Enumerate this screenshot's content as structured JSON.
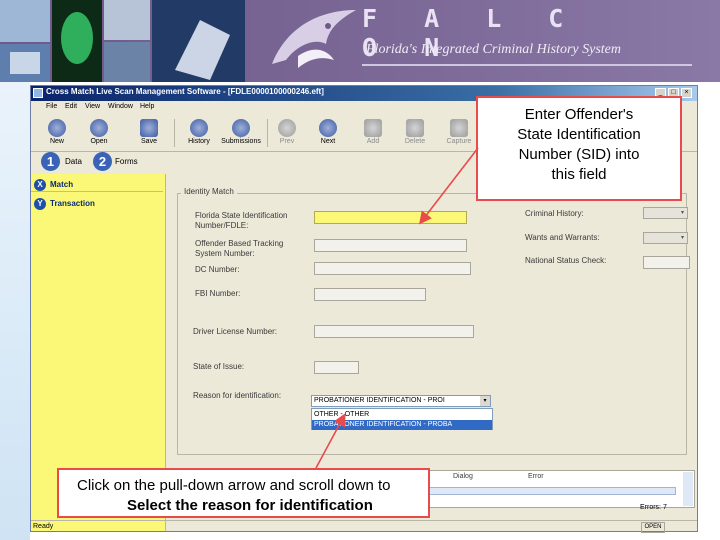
{
  "banner": {
    "title": "F A L C O N",
    "subtitle": "Florida's Integrated Criminal History System"
  },
  "window": {
    "title": "Cross Match Live Scan Management Software - [FDLE0000100000246.eft]",
    "controls": [
      "_",
      "□",
      "×"
    ]
  },
  "menu": [
    "File",
    "Edit",
    "View",
    "Window",
    "Help"
  ],
  "toolbar": [
    {
      "label": "New",
      "icon": "new-icon",
      "enabled": true
    },
    {
      "label": "Open",
      "icon": "open-folder-icon",
      "enabled": true
    },
    {
      "label": "Save",
      "icon": "save-disk-icon",
      "enabled": true
    },
    {
      "label": "History",
      "icon": "history-icon",
      "enabled": true
    },
    {
      "label": "Submissions",
      "icon": "submissions-icon",
      "enabled": true
    },
    {
      "label": "Prev",
      "icon": "prev-arrow-icon",
      "enabled": false
    },
    {
      "label": "Next",
      "icon": "next-arrow-icon",
      "enabled": true
    },
    {
      "label": "Add",
      "icon": "add-icon",
      "enabled": false
    },
    {
      "label": "Delete",
      "icon": "delete-icon",
      "enabled": false
    },
    {
      "label": "Capture",
      "icon": "capture-icon",
      "enabled": false
    }
  ],
  "wizard": [
    {
      "number": "1",
      "label": "Data"
    },
    {
      "number": "2",
      "label": "Forms"
    }
  ],
  "nav": [
    {
      "icon_glyph": "X",
      "label": "Match"
    },
    {
      "icon_glyph": "Y",
      "label": "Transaction"
    }
  ],
  "form": {
    "legend": "Identity Match",
    "sid_label": "Florida State Identification Number/FDLE:",
    "obts_label": "Offender Based Tracking System Number:",
    "dc_label": "DC Number:",
    "fbi_label": "FBI Number:",
    "dl_label": "Driver License Number:",
    "state_label": "State of Issue:",
    "reason_label": "Reason for identification:",
    "reason_value": "PROBATIONER IDENTIFICATION - PROI",
    "reason_options": [
      "OTHER - OTHER",
      "PROBATIONER IDENTIFICATION - PROBA"
    ],
    "criminal_history_label": "Criminal History:",
    "wants_label": "Wants and Warrants:",
    "national_label": "National Status Check:"
  },
  "grid": {
    "headers": [
      "Dialog",
      "Error"
    ]
  },
  "status": {
    "errors": "Errors: 7",
    "ready": "Ready",
    "open": "OPEN"
  },
  "callouts": {
    "sid": [
      "Enter Offender's",
      "State Identification",
      "Number (SID) into",
      "this field"
    ],
    "reason_line1": "Click on the pull-down arrow and scroll down to",
    "reason_line2": "Select the reason for identification"
  },
  "colors": {
    "nav_yellow": "#fbf777",
    "callout_red": "#e84b4b",
    "banner_purple": "#7d6a98",
    "selection_blue": "#316ac5"
  }
}
